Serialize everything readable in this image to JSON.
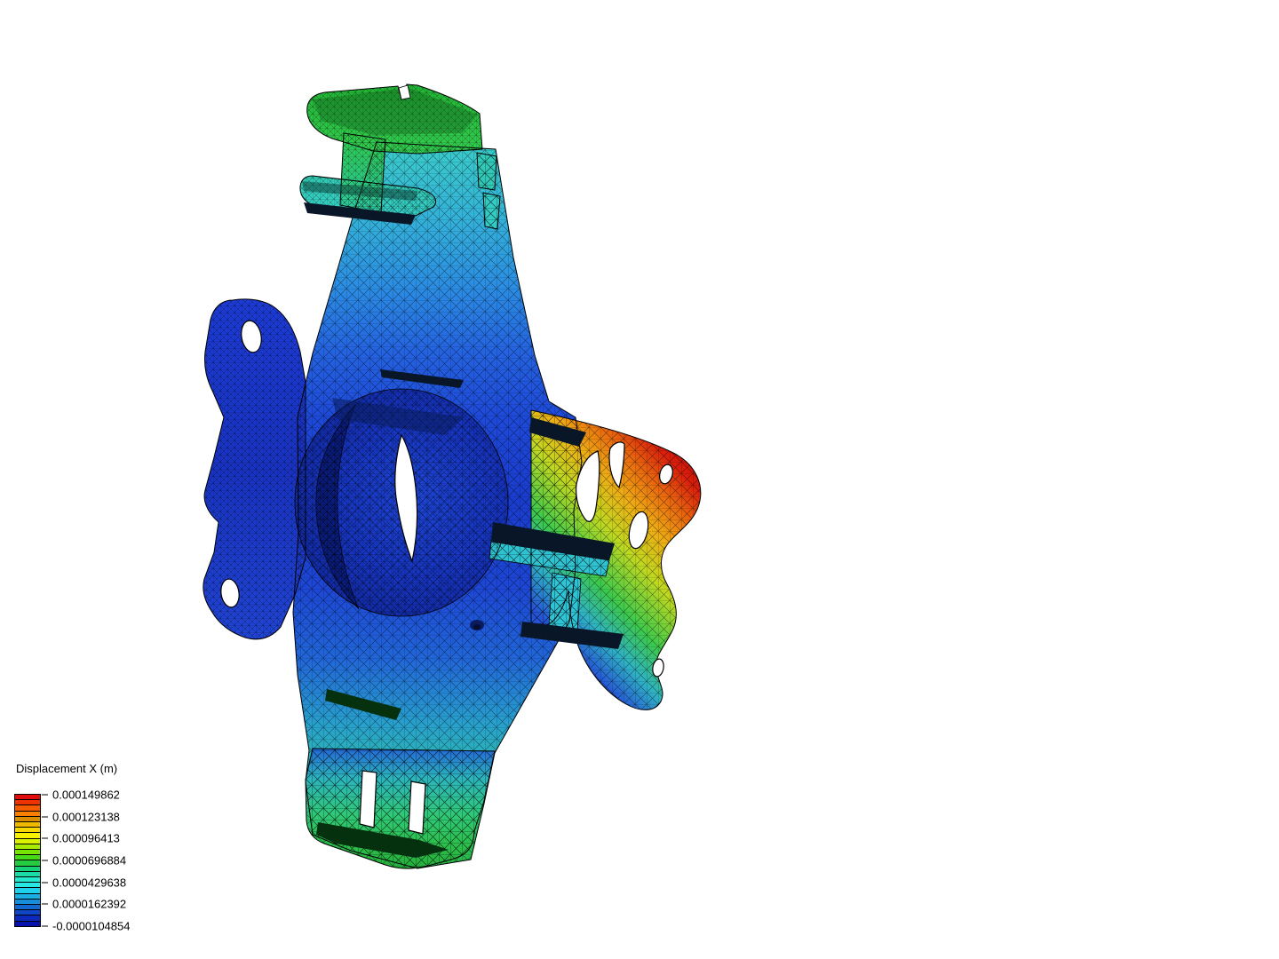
{
  "app": {
    "background": "#ffffff"
  },
  "legend": {
    "title": "Displacement X (m)",
    "ticks": [
      "0.000149862",
      "0.000123138",
      "0.000096413",
      "0.0000696884",
      "0.0000429638",
      "0.0000162392",
      "-0.0000104854"
    ],
    "colorbar_colors": [
      "#e00b0b",
      "#ee3300",
      "#f55c00",
      "#f97f00",
      "#d98d00",
      "#efba00",
      "#f5d800",
      "#f8f200",
      "#d8f200",
      "#a6ec00",
      "#74e400",
      "#46da16",
      "#26cc40",
      "#17d077",
      "#1bdca4",
      "#23e8cc",
      "#27e8e4",
      "#1fd0ec",
      "#1aafe2",
      "#178cd8",
      "#1368d0",
      "#0f46c6",
      "#0b2abc",
      "#0712ac"
    ]
  }
}
